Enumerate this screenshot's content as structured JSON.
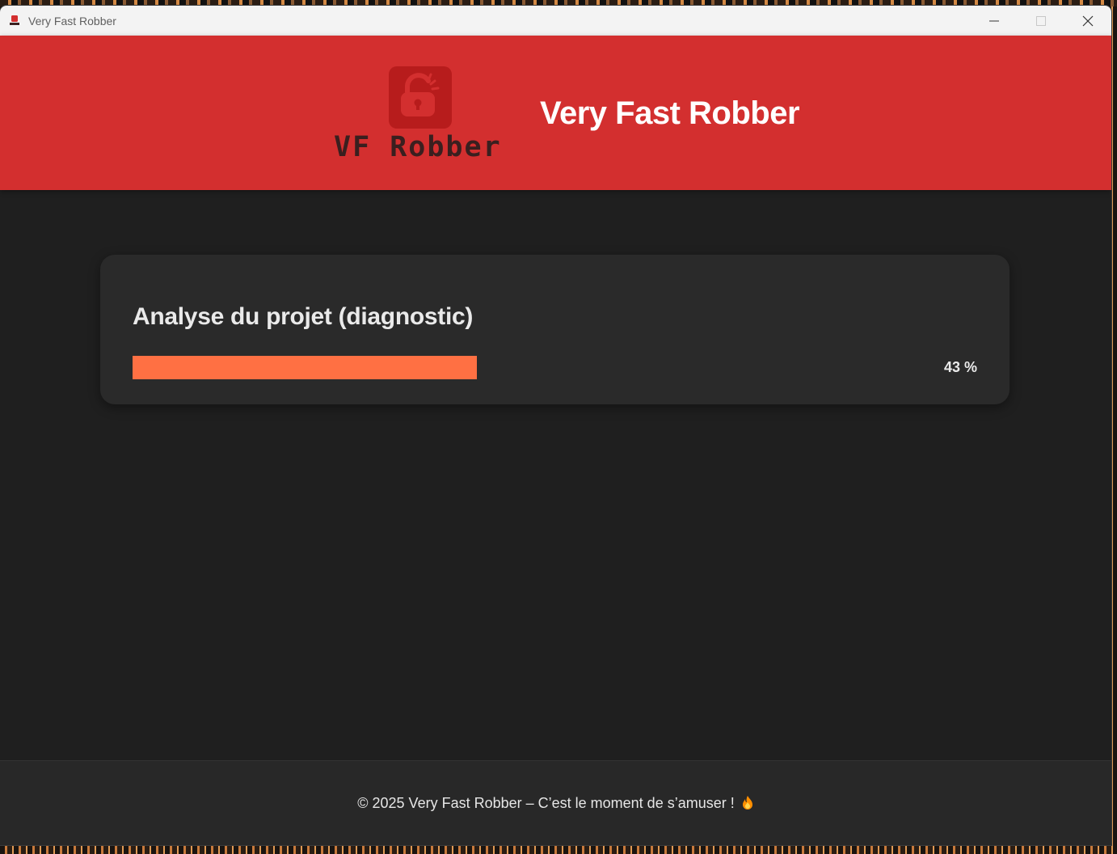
{
  "window": {
    "title": "Very Fast Robber"
  },
  "header": {
    "logo_text": "VF Robber",
    "title": "Very Fast Robber",
    "background": "#d32f2f"
  },
  "card": {
    "title": "Analyse du projet (diagnostic)",
    "progress_percent": 43,
    "progress_label": "43 %",
    "accent": "#ff7043"
  },
  "footer": {
    "text": "© 2025 Very Fast Robber – C’est le moment de s’amuser !",
    "emoji_icon": "flame-icon"
  }
}
